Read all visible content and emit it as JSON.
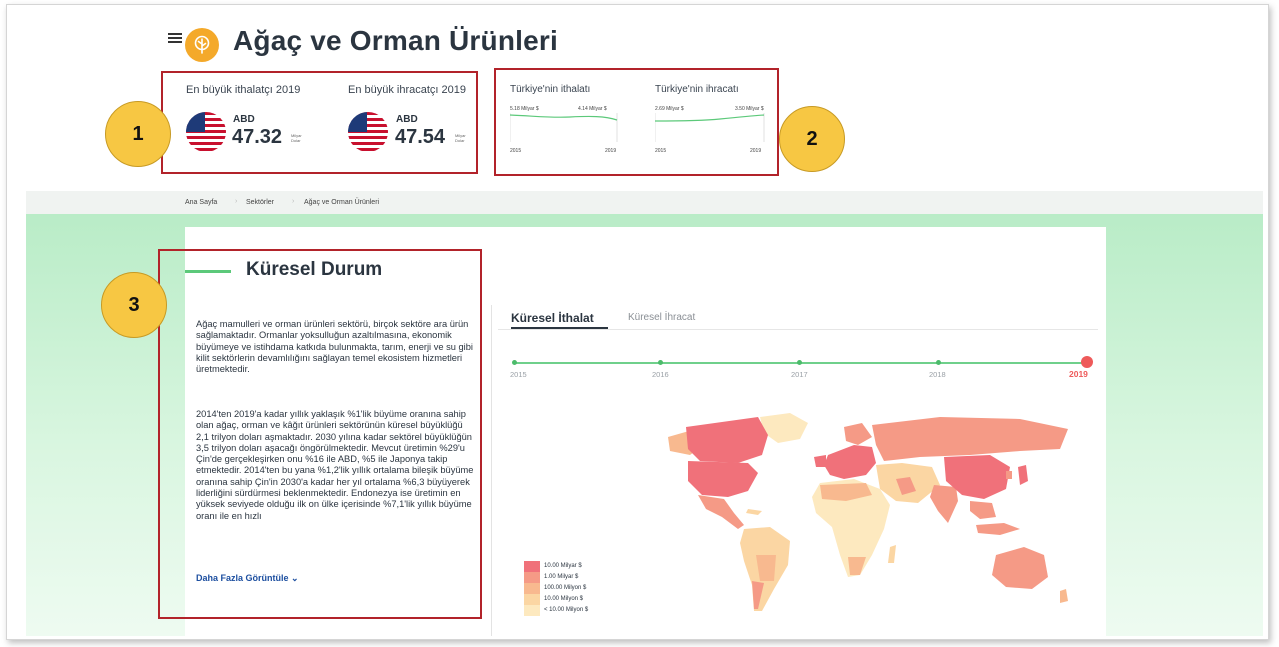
{
  "header": {
    "title": "Ağaç ve Orman Ürünleri"
  },
  "top_stats": {
    "importer": {
      "title": "En büyük ithalatçı 2019",
      "country": "ABD",
      "value": "47.32",
      "unit": "Milyar Dolar"
    },
    "exporter": {
      "title": "En büyük ihracatçı 2019",
      "country": "ABD",
      "value": "47.54",
      "unit": "Milyar Dolar"
    }
  },
  "turkey_charts": {
    "import": {
      "title": "Türkiye'nin ithalatı",
      "start_value": "5.18 Milyar $",
      "end_value": "4.14 Milyar $",
      "start_year": "2015",
      "end_year": "2019"
    },
    "export": {
      "title": "Türkiye'nin ihracatı",
      "start_value": "2.69 Milyar $",
      "end_value": "3.50 Milyar $",
      "start_year": "2015",
      "end_year": "2019"
    }
  },
  "callouts": [
    "1",
    "2",
    "3"
  ],
  "breadcrumb": [
    "Ana Sayfa",
    "Sektörler",
    "Ağaç ve Orman Ürünleri"
  ],
  "global": {
    "title": "Küresel Durum",
    "paragraph1": "Ağaç mamulleri ve orman ürünleri sektörü, birçok sektöre ara ürün sağlamaktadır. Ormanlar yoksulluğun azaltılmasına, ekonomik büyümeye ve istihdama katkıda bulunmakta, tarım, enerji ve su gibi kilit sektörlerin devamlılığını sağlayan temel ekosistem hizmetleri üretmektedir.",
    "paragraph2": "2014'ten 2019'a kadar yıllık yaklaşık %1'lik büyüme oranına sahip olan ağaç, orman ve kâğıt ürünleri sektörünün küresel büyüklüğü 2,1 trilyon doları aşmaktadır. 2030 yılına kadar sektörel büyüklüğün 3,5 trilyon doları aşacağı öngörülmektedir. Mevcut üretimin %29'u Çin'de gerçekleşirken onu %16 ile ABD, %5 ile Japonya takip etmektedir. 2014'ten bu yana %1,2'lik yıllık ortalama bileşik büyüme oranına sahip Çin'in 2030'a kadar her yıl ortalama %6,3 büyüyerek liderliğini sürdürmesi beklenmektedir. Endonezya ise üretimin en yüksek seviyede olduğu ilk on ülke içerisinde %7,1'lik yıllık büyüme oranı ile en hızlı",
    "more_label": "Daha Fazla Görüntüle ⌄"
  },
  "tabs": {
    "active": "Küresel İthalat",
    "inactive": "Küresel İhracat"
  },
  "timeline": {
    "years": [
      "2015",
      "2016",
      "2017",
      "2018",
      "2019"
    ],
    "selected": "2019"
  },
  "legend": [
    {
      "label": "10.00 Milyar $",
      "color": "#f0717a"
    },
    {
      "label": "1.00 Milyar $",
      "color": "#f59a86"
    },
    {
      "label": "100.00 Milyon $",
      "color": "#f8b98f"
    },
    {
      "label": "10.00 Milyon $",
      "color": "#fbd6a3"
    },
    {
      "label": "< 10.00 Milyon $",
      "color": "#fde9bf"
    }
  ],
  "colors": {
    "accent_green": "#5cc97a",
    "highlight_red": "#b2232a",
    "callout_yellow": "#f7c743",
    "logo_orange": "#f4a92a"
  }
}
